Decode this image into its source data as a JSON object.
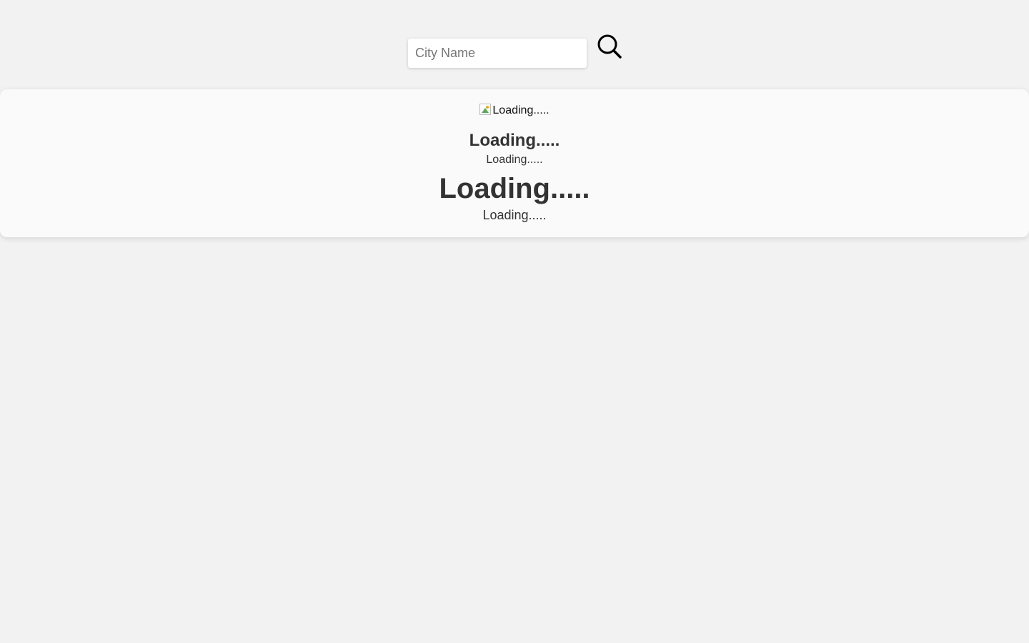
{
  "search": {
    "placeholder": "City Name",
    "value": "",
    "button_icon": "search-icon"
  },
  "weather": {
    "icon_alt": "Loading.....",
    "city": "Loading.....",
    "description": "Loading.....",
    "temperature": "Loading.....",
    "detail": "Loading....."
  },
  "colors": {
    "page_background": "#f2f2f2",
    "card_background": "#fafafa",
    "text": "#333333"
  }
}
